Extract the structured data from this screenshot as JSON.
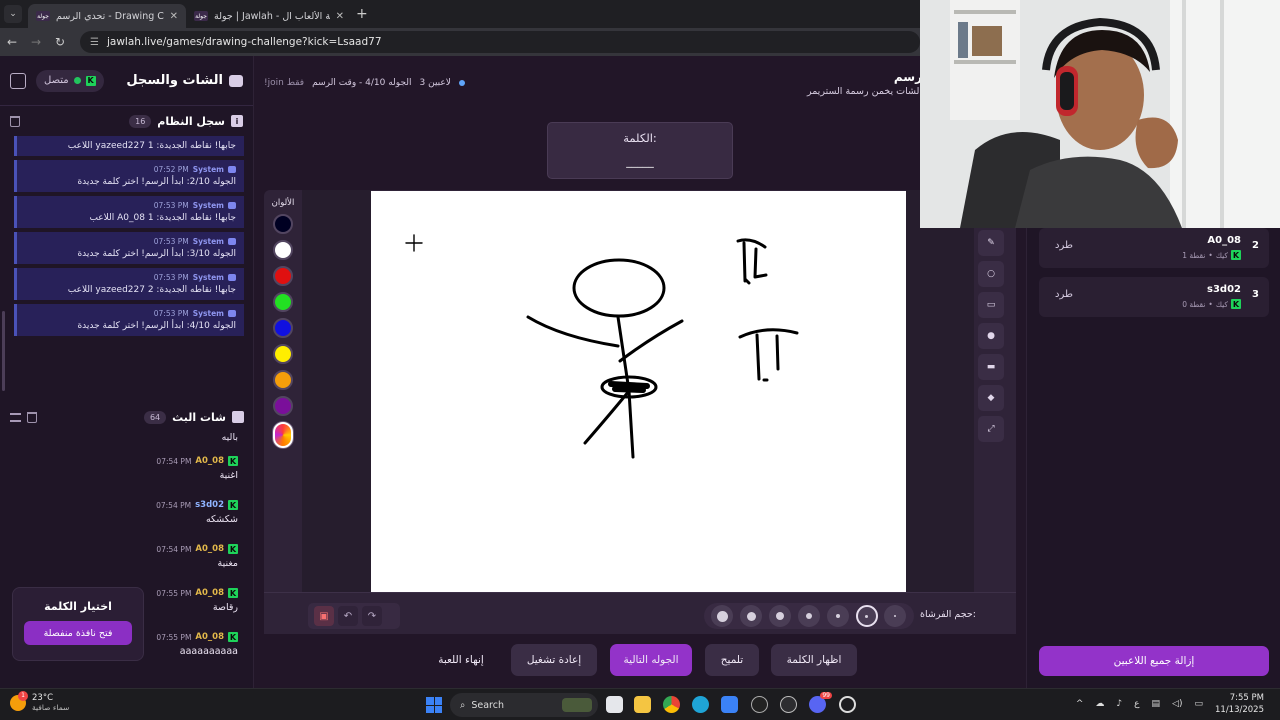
{
  "browser": {
    "tabs": [
      {
        "title": "تحدي الرسم - Drawing Challenge",
        "active": true
      },
      {
        "title": "جولة | Jawlah - منصة الألعاب ال...",
        "active": false
      }
    ],
    "url": "jawlah.live/games/drawing-challenge?kick=Lsaad77"
  },
  "left_panel": {
    "title": "الشات والسجل",
    "online_label": "متصل",
    "system_log": {
      "title": "سجل النظام",
      "count": "16",
      "items": [
        {
          "sender": "",
          "time": "",
          "message": "اللاعب yazeed227 جابها! نقاطه الجديدة: 1"
        },
        {
          "sender": "System",
          "time": "07:52 PM",
          "message": "الجوله 2/10: ابدأ الرسم! اختر كلمة جديدة"
        },
        {
          "sender": "System",
          "time": "07:53 PM",
          "message": "اللاعب A0_08 جابها! نقاطه الجديدة: 1"
        },
        {
          "sender": "System",
          "time": "07:53 PM",
          "message": "الجوله 3/10: ابدأ الرسم! اختر كلمة جديدة"
        },
        {
          "sender": "System",
          "time": "07:53 PM",
          "message": "اللاعب yazeed227 جابها! نقاطه الجديدة: 2"
        },
        {
          "sender": "System",
          "time": "07:53 PM",
          "message": "الجوله 4/10: ابدأ الرسم! اختر كلمة جديدة"
        }
      ]
    },
    "stream_chat": {
      "title": "شات البث",
      "count": "64",
      "top_message": "باليه",
      "items": [
        {
          "user": "A0_08",
          "time": "07:54 PM",
          "message": "اغنية"
        },
        {
          "user": "s3d02",
          "time": "07:54 PM",
          "message": "شكشكه"
        },
        {
          "user": "A0_08",
          "time": "07:54 PM",
          "message": "مغنية"
        },
        {
          "user": "A0_08",
          "time": "07:55 PM",
          "message": "رقاصة"
        },
        {
          "user": "A0_08",
          "time": "07:55 PM",
          "message": "aaaaaaaaaa"
        }
      ]
    },
    "word_card": {
      "title": "اختيار الكلمة",
      "button": "فتح نافذة منفصلة"
    }
  },
  "center": {
    "title": "رسم",
    "subtitle": "الشات يخمن رسمة الستريمر",
    "players_status": "3 لاعبين",
    "round_status": "الجوله 4/10 - وقت الرسم",
    "join_note": "!join فقط",
    "word_label": "الكلمة:",
    "word_blank": "_____",
    "colors_label": "الألوان",
    "colors": [
      "#000022",
      "#ffffff",
      "#e01010",
      "#22e022",
      "#1010e0",
      "#ffee00",
      "#f59e0b",
      "#7a0f9a"
    ],
    "brush_label": "حجم الفرشاة:",
    "actions": {
      "end_game": "إنهاء اللعبة",
      "restart": "إعادة تشغيل",
      "next_round": "الجوله التالية",
      "hint": "تلميح",
      "show_word": "اظهار الكلمة"
    }
  },
  "right_panel": {
    "players": [
      {
        "rank": "2",
        "name": "A0_08",
        "platform": "كيك",
        "points": "1 نقطة",
        "kick_label": "طرد"
      },
      {
        "rank": "3",
        "name": "s3d02",
        "platform": "كيك",
        "points": "0 نقطة",
        "kick_label": "طرد"
      }
    ],
    "remove_all": "إزالة جميع اللاعبين"
  },
  "taskbar": {
    "temperature": "23°C",
    "weather": "سماء صافية",
    "search_placeholder": "Search",
    "language": "ع",
    "time": "7:55 PM",
    "date": "11/13/2025",
    "notifications": "1",
    "discord_badge": "99"
  }
}
